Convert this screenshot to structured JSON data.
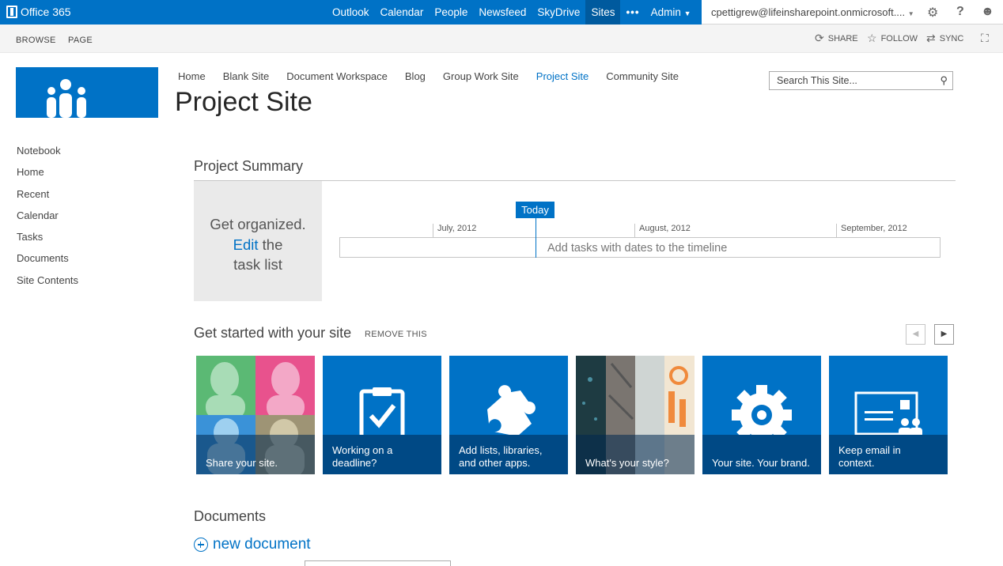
{
  "suite": {
    "brand": "Office 365",
    "nav": [
      "Outlook",
      "Calendar",
      "People",
      "Newsfeed",
      "SkyDrive",
      "Sites",
      "Admin"
    ],
    "active": "Sites",
    "ellipsis": "•••",
    "user": "cpettigrew@lifeinsharepoint.onmicrosoft....",
    "accent": "#0072c6"
  },
  "ribbon": {
    "tabs": [
      "BROWSE",
      "PAGE"
    ],
    "actions": [
      "SHARE",
      "FOLLOW",
      "SYNC"
    ]
  },
  "topnav": [
    "Home",
    "Blank Site",
    "Document Workspace",
    "Blog",
    "Group Work Site",
    "Project Site",
    "Community Site"
  ],
  "site_title": "Project Site",
  "search": {
    "placeholder": "Search This Site..."
  },
  "leftnav": [
    "Notebook",
    "Home",
    "Recent",
    "Calendar",
    "Tasks",
    "Documents",
    "Site Contents"
  ],
  "summary": {
    "heading": "Project Summary",
    "line1": "Get organized.",
    "edit": "Edit",
    "line2_rest": " the",
    "line3": "task list",
    "today": "Today",
    "months": [
      "July, 2012",
      "August, 2012",
      "September, 2012"
    ],
    "timeline_text": "Add tasks with dates to the timeline"
  },
  "getstarted": {
    "heading": "Get started with your site",
    "remove": "REMOVE THIS",
    "tiles": [
      "Share your site.",
      "Working on a deadline?",
      "Add lists, libraries, and other apps.",
      "What's your style?",
      "Your site. Your brand.",
      "Keep email in context."
    ]
  },
  "documents": {
    "heading": "Documents",
    "new": "new document"
  }
}
